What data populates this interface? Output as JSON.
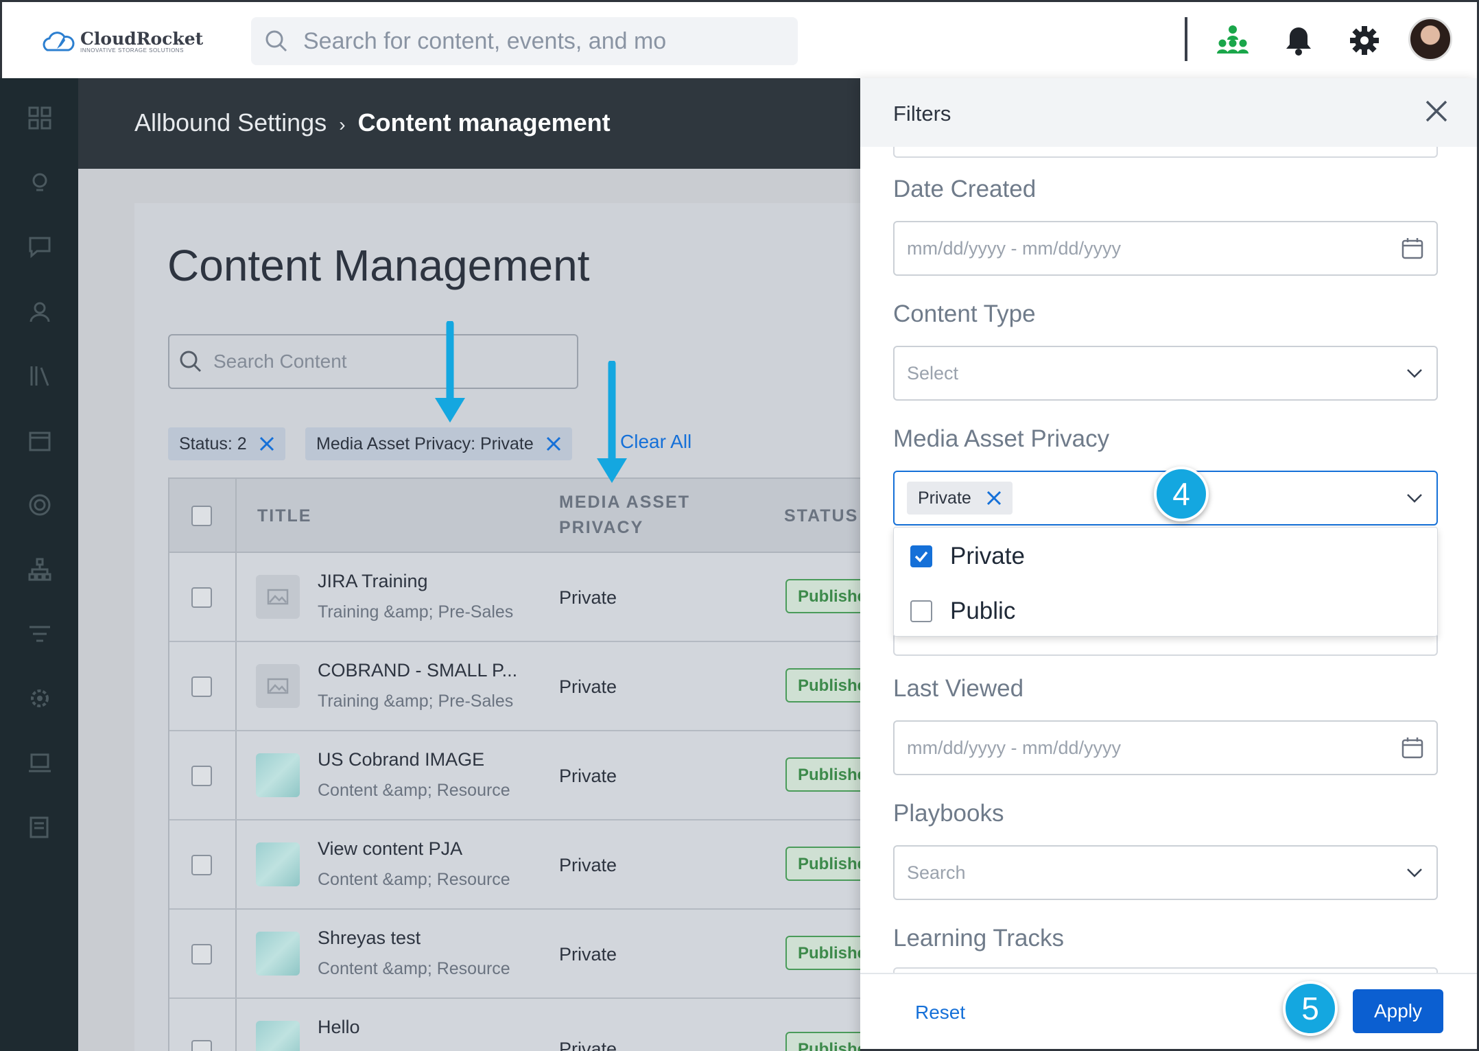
{
  "topbar": {
    "brand_name": "CloudRocket",
    "brand_tagline": "INNOVATIVE STORAGE SOLUTIONS",
    "search_placeholder": "Search for content, events, and mo",
    "icons": [
      "org-chart-icon",
      "bell-icon",
      "gear-icon",
      "avatar"
    ],
    "accent_color": "#1aa64a"
  },
  "sidebar": {
    "icons": [
      "dashboard-icon",
      "lightbulb-icon",
      "chat-icon",
      "team-icon",
      "library-icon",
      "calendar-icon",
      "target-icon",
      "hierarchy-icon",
      "filter-icon",
      "settings-icon",
      "laptop-icon",
      "report-icon"
    ]
  },
  "header": {
    "breadcrumb_parent": "Allbound Settings",
    "breadcrumb_separator": "›",
    "breadcrumb_current": "Content management"
  },
  "main": {
    "title": "Content Management",
    "search_placeholder": "Search Content",
    "chips": [
      {
        "label": "Status: 2"
      },
      {
        "label": "Media Asset Privacy: Private"
      }
    ],
    "clear_all": "Clear All",
    "table": {
      "headers": {
        "title": "TITLE",
        "privacy_line1": "MEDIA ASSET",
        "privacy_line2": "PRIVACY",
        "status": "STATUS"
      },
      "rows": [
        {
          "title": "JIRA Training",
          "category": "Training &amp; Pre-Sales",
          "privacy": "Private",
          "status": "Published",
          "thumb": "image-placeholder"
        },
        {
          "title": "COBRAND - SMALL P...",
          "category": "Training &amp; Pre-Sales",
          "privacy": "Private",
          "status": "Published",
          "thumb": "image-placeholder"
        },
        {
          "title": "US Cobrand IMAGE",
          "category": "Content &amp; Resource",
          "privacy": "Private",
          "status": "Published",
          "thumb": "image"
        },
        {
          "title": "View content PJA",
          "category": "Content &amp; Resource",
          "privacy": "Private",
          "status": "Published",
          "thumb": "image"
        },
        {
          "title": "Shreyas test",
          "category": "Content &amp; Resource",
          "privacy": "Private",
          "status": "Published",
          "thumb": "image"
        },
        {
          "title": "Hello",
          "category": "",
          "privacy": "Private",
          "status": "Published",
          "thumb": "image"
        }
      ]
    }
  },
  "filters": {
    "title": "Filters",
    "date_created": {
      "label": "Date Created",
      "placeholder": "mm/dd/yyyy - mm/dd/yyyy"
    },
    "content_type": {
      "label": "Content Type",
      "placeholder": "Select"
    },
    "media_asset_privacy": {
      "label": "Media Asset Privacy",
      "selected_chip": "Private",
      "options": [
        {
          "label": "Private",
          "checked": true
        },
        {
          "label": "Public",
          "checked": false
        }
      ]
    },
    "last_viewed": {
      "label": "Last Viewed",
      "placeholder": "mm/dd/yyyy - mm/dd/yyyy"
    },
    "playbooks": {
      "label": "Playbooks",
      "placeholder": "Search"
    },
    "learning_tracks": {
      "label": "Learning Tracks"
    },
    "reset": "Reset",
    "apply": "Apply"
  },
  "annotations": {
    "step_4": "4",
    "step_5": "5",
    "callout_color": "#14a7e0"
  }
}
